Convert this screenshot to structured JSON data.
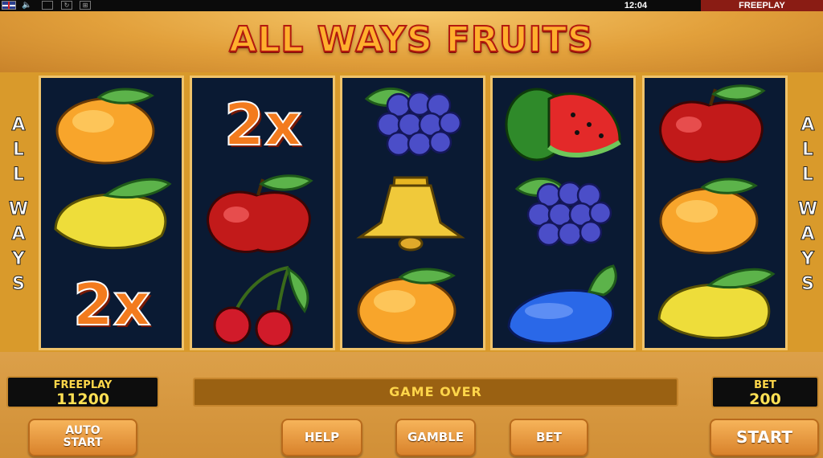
{
  "topbar": {
    "flag_icon": "uk-flag-icon",
    "sound_icon": "speaker-icon",
    "clock": "12:04",
    "mode": "FREEPLAY"
  },
  "header": {
    "title": "ALL WAYS FRUITS"
  },
  "side_label": {
    "words": [
      "ALL",
      "WAYS"
    ]
  },
  "reels": [
    [
      "orange",
      "lemon",
      "2x"
    ],
    [
      "2x",
      "apple",
      "cherries"
    ],
    [
      "grapes",
      "bell",
      "orange"
    ],
    [
      "watermelon",
      "grapes",
      "plum"
    ],
    [
      "apple",
      "orange",
      "lemon"
    ]
  ],
  "wild_symbol_text": "2x",
  "status": {
    "credit_label": "FREEPLAY",
    "credit_value": "11200",
    "message": "GAME OVER",
    "bet_label": "BET",
    "bet_value": "200"
  },
  "buttons": {
    "auto_start_line1": "AUTO",
    "auto_start_line2": "START",
    "help": "HELP",
    "gamble": "GAMBLE",
    "bet": "BET",
    "start": "START"
  },
  "colors": {
    "frame_gold": "#d99a2b",
    "reel_bg": "#0a1a33",
    "title_fill": "#ffb02e",
    "title_stroke": "#b3190f",
    "mode_badge": "#8a1c14"
  }
}
